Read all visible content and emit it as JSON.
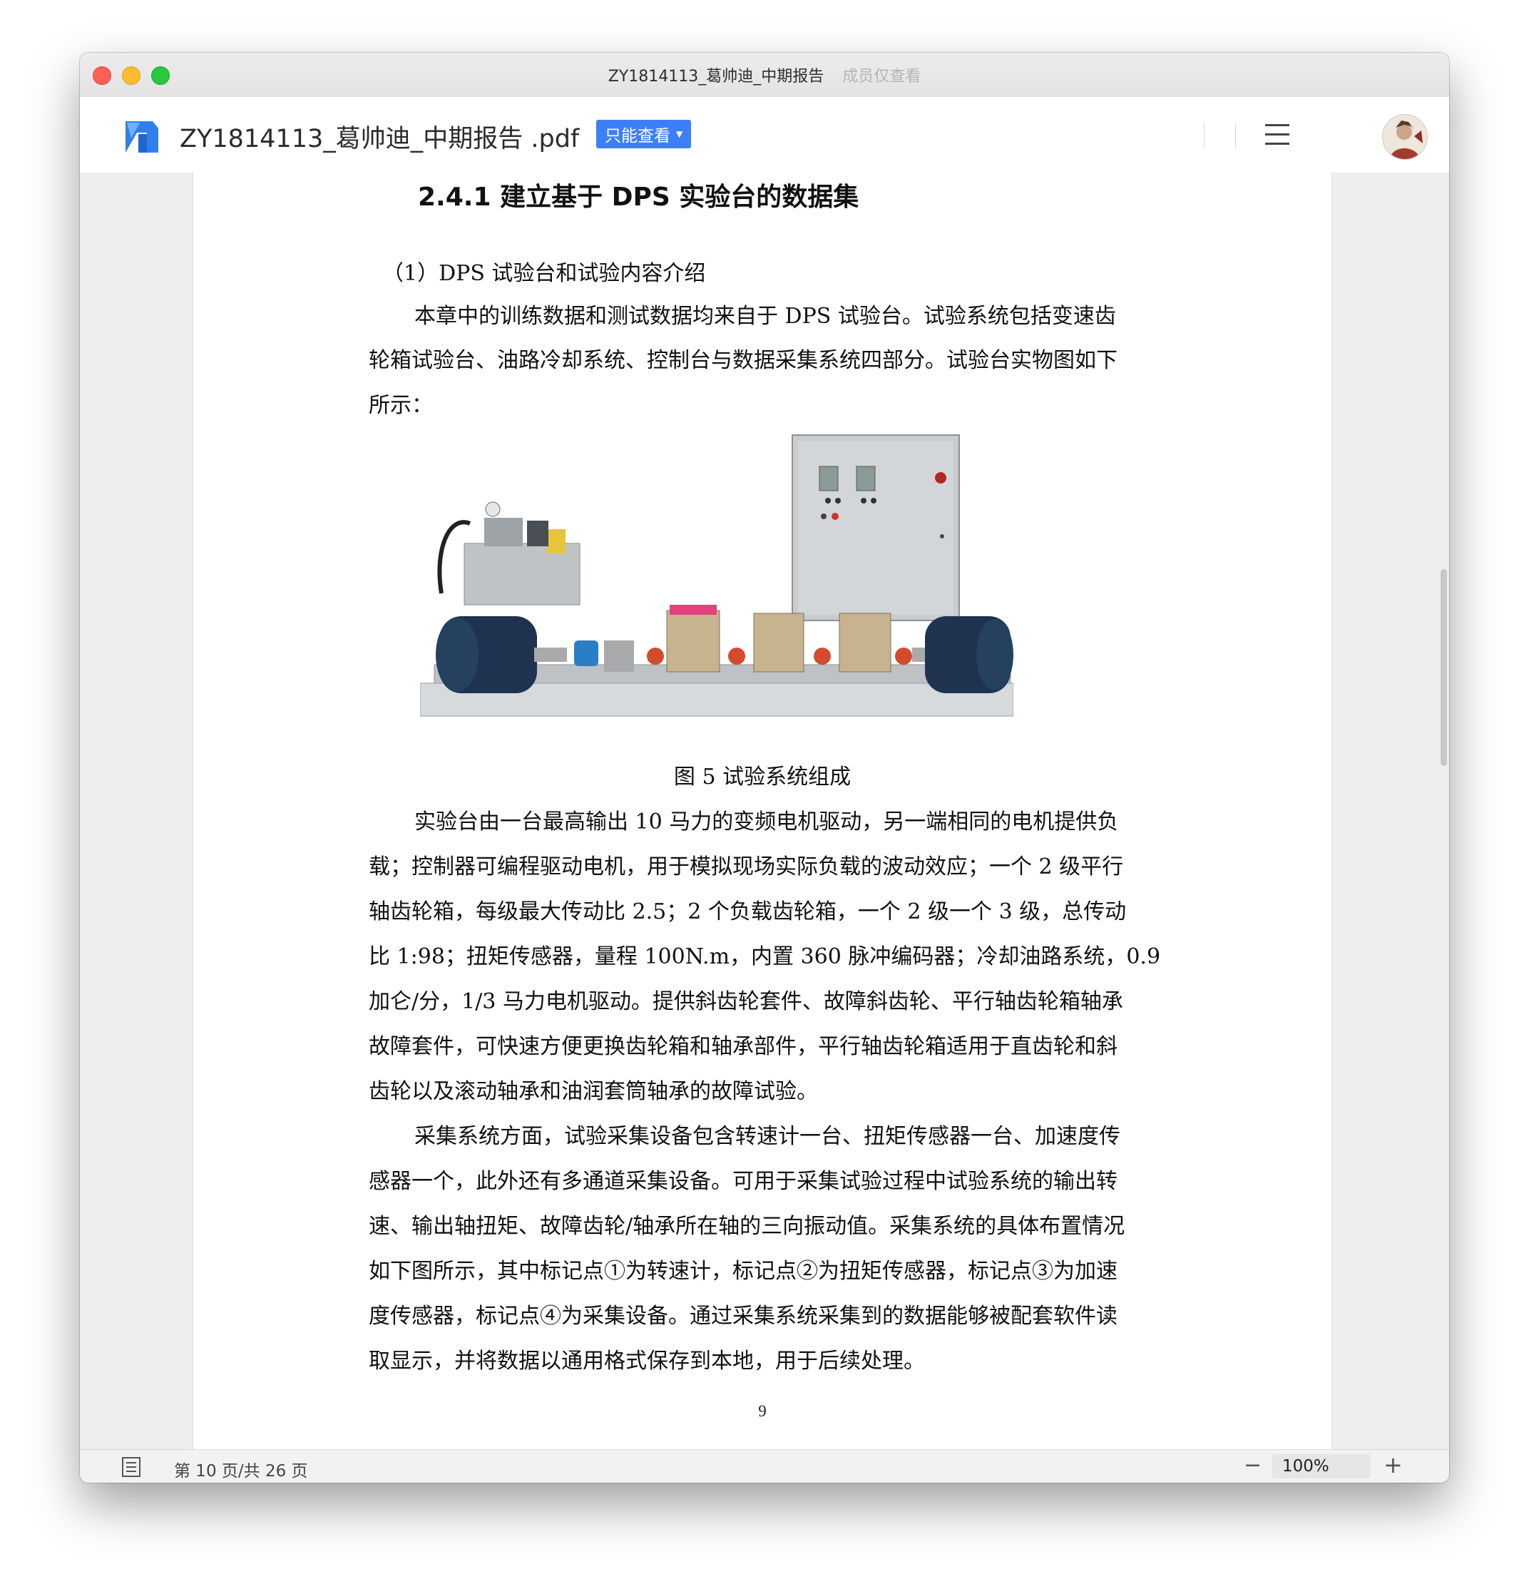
{
  "window": {
    "title": "ZY1814113_葛帅迪_中期报告",
    "subtitle": "成员仅查看"
  },
  "appbar": {
    "doc_name": "ZY1814113_葛帅迪_中期报告 .pdf",
    "permission_label": "只能查看",
    "logo_icon": "app-logo-icon",
    "menu_icon": "hamburger-menu-icon",
    "avatar": "user-avatar"
  },
  "document": {
    "heading": "2.4.1  建立基于 DPS 实验台的数据集",
    "subheading": "（1）DPS 试验台和试验内容介绍",
    "para1": [
      "本章中的训练数据和测试数据均来自于 DPS 试验台。试验系统包括变速齿",
      "轮箱试验台、油路冷却系统、控制台与数据采集系统四部分。试验台实物图如下",
      "所示："
    ],
    "figure_caption": "图 5 试验系统组成",
    "para2": [
      "实验台由一台最高输出 10 马力的变频电机驱动，另一端相同的电机提供负",
      "载；控制器可编程驱动电机，用于模拟现场实际负载的波动效应；一个 2 级平行",
      "轴齿轮箱，每级最大传动比 2.5；2 个负载齿轮箱，一个 2 级一个 3 级，总传动",
      "比 1:98；扭矩传感器，量程  100N.m，内置  360  脉冲编码器；冷却油路系统，0.9",
      "加仑/分，1/3  马力电机驱动。提供斜齿轮套件、故障斜齿轮、平行轴齿轮箱轴承",
      "故障套件，可快速方便更换齿轮箱和轴承部件，平行轴齿轮箱适用于直齿轮和斜",
      "齿轮以及滚动轴承和油润套筒轴承的故障试验。"
    ],
    "para3": [
      "采集系统方面，试验采集设备包含转速计一台、扭矩传感器一台、加速度传",
      "感器一个，此外还有多通道采集设备。可用于采集试验过程中试验系统的输出转",
      "速、输出轴扭矩、故障齿轮/轴承所在轴的三向振动值。采集系统的具体布置情况",
      "如下图所示，其中标记点①为转速计，标记点②为扭矩传感器，标记点③为加速",
      "度传感器，标记点④为采集设备。通过采集系统采集到的数据能够被配套软件读",
      "取显示，并将数据以通用格式保存到本地，用于后续处理。"
    ],
    "page_number": "9"
  },
  "statusbar": {
    "page_info": "第 10 页/共 26 页",
    "zoom": "100%",
    "zoom_out": "−",
    "zoom_in": "+"
  },
  "colors": {
    "accent": "#3d7ff6",
    "logo": "#2f80ed"
  }
}
